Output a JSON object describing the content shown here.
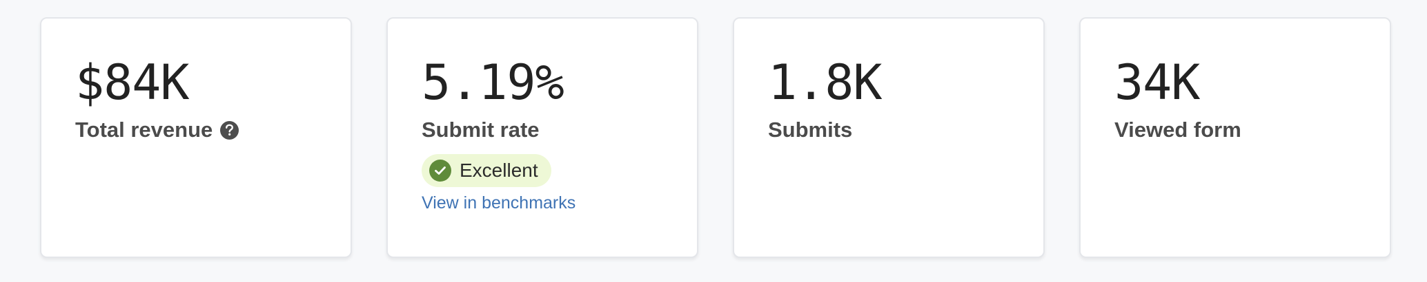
{
  "metrics": [
    {
      "value": "$84K",
      "label": "Total revenue",
      "help_icon": "question-icon"
    },
    {
      "value": "5.19%",
      "label": "Submit rate",
      "badge": {
        "label": "Excellent",
        "icon": "check-circle-icon",
        "color": "#5f8b3a",
        "background": "#eef8d6"
      },
      "link": "View in benchmarks"
    },
    {
      "value": "1.8K",
      "label": "Submits"
    },
    {
      "value": "34K",
      "label": "Viewed form"
    }
  ],
  "colors": {
    "page_background": "#f7f8fa",
    "card_background": "#ffffff",
    "value_text": "#222222",
    "label_text": "#4b4b4b",
    "link": "#3f73b4"
  }
}
